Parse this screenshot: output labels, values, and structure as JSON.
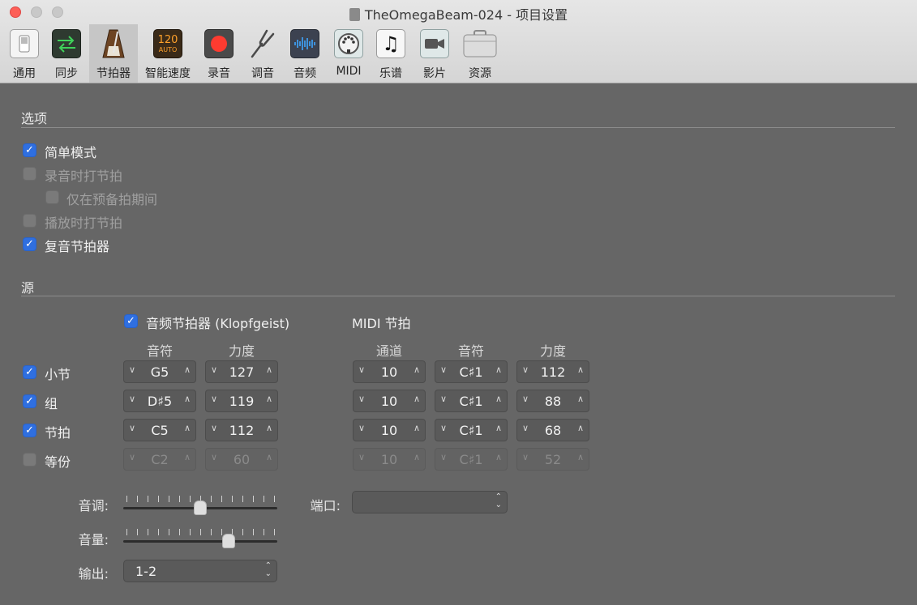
{
  "window": {
    "title": "TheOmegaBeam-024 - 项目设置"
  },
  "toolbar": {
    "items": [
      {
        "label": "通用",
        "icon": "switch-icon"
      },
      {
        "label": "同步",
        "icon": "sync-arrows-icon"
      },
      {
        "label": "节拍器",
        "icon": "metronome-icon"
      },
      {
        "label": "智能速度",
        "icon": "smart-tempo-icon",
        "badge_top": "120",
        "badge_bottom": "AUTO"
      },
      {
        "label": "录音",
        "icon": "record-icon"
      },
      {
        "label": "调音",
        "icon": "tuning-fork-icon"
      },
      {
        "label": "音频",
        "icon": "audio-waveform-icon"
      },
      {
        "label": "MIDI",
        "icon": "midi-connector-icon"
      },
      {
        "label": "乐谱",
        "icon": "score-note-icon",
        "glyph": "♫"
      },
      {
        "label": "影片",
        "icon": "movie-camera-icon"
      },
      {
        "label": "资源",
        "icon": "assets-case-icon"
      }
    ],
    "selected_index": 2
  },
  "options": {
    "title": "选项",
    "items": [
      {
        "label": "简单模式",
        "checked": true,
        "enabled": true
      },
      {
        "label": "录音时打节拍",
        "checked": false,
        "enabled": false
      },
      {
        "label": "仅在预备拍期间",
        "checked": false,
        "enabled": false
      },
      {
        "label": "播放时打节拍",
        "checked": false,
        "enabled": false
      },
      {
        "label": "复音节拍器",
        "checked": true,
        "enabled": true
      }
    ]
  },
  "source": {
    "title": "源",
    "audio_click": {
      "label": "音频节拍器 (Klopfgeist)",
      "checked": true
    },
    "midi_click_label": "MIDI 节拍",
    "headers": {
      "note": "音符",
      "velocity": "力度",
      "channel": "通道",
      "midi_note": "音符",
      "midi_velocity": "力度"
    },
    "rows": [
      {
        "label": "小节",
        "checked": true,
        "note": "G5",
        "velocity": "127",
        "channel": "10",
        "midi_note": "C♯1",
        "midi_velocity": "112",
        "enabled": true
      },
      {
        "label": "组",
        "checked": true,
        "note": "D♯5",
        "velocity": "119",
        "channel": "10",
        "midi_note": "C♯1",
        "midi_velocity": "88",
        "enabled": true
      },
      {
        "label": "节拍",
        "checked": true,
        "note": "C5",
        "velocity": "112",
        "channel": "10",
        "midi_note": "C♯1",
        "midi_velocity": "68",
        "enabled": true
      },
      {
        "label": "等份",
        "checked": false,
        "note": "C2",
        "velocity": "60",
        "channel": "10",
        "midi_note": "C♯1",
        "midi_velocity": "52",
        "enabled": false
      }
    ],
    "tone_label": "音调:",
    "tone_level": 0.5,
    "volume_label": "音量:",
    "volume_level": 0.7,
    "output_label": "输出:",
    "output_value": "1-2",
    "port_label": "端口:",
    "port_value": ""
  },
  "colors": {
    "accent": "#2f6fe0",
    "record": "#ff3b30",
    "window_bg": "#666666"
  }
}
